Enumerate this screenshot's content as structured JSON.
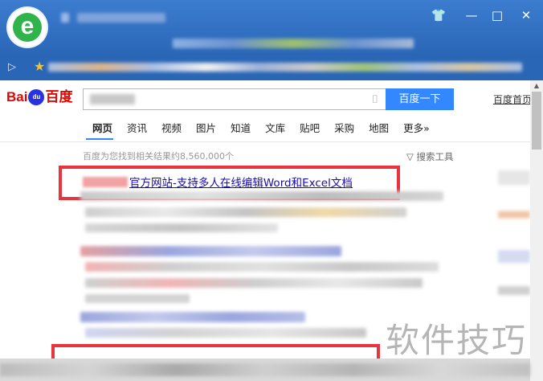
{
  "window": {
    "minimize_glyph": "—",
    "maximize_glyph": "□",
    "close_glyph": "✕"
  },
  "baidu": {
    "logo_bai": "Bai",
    "logo_paw": "du",
    "logo_du": "百度",
    "search_button": "百度一下",
    "home_link": "百度首页"
  },
  "tabs": [
    "网页",
    "资讯",
    "视频",
    "图片",
    "知道",
    "文库",
    "贴吧",
    "采购",
    "地图",
    "更多»"
  ],
  "results": {
    "count_text": "百度为您找到相关结果约8,560,000个",
    "tools_label": "搜索工具",
    "first_title": "官方网站-支持多人在线编辑Word和Excel文档"
  },
  "watermark": "软件技巧",
  "colors": {
    "browser_blue": "#2a66b6",
    "baidu_red": "#e10601",
    "baidu_blue": "#2932e1",
    "search_button": "#3388ff",
    "highlight_red": "#e8343c",
    "link_blue": "#1a0dab"
  }
}
